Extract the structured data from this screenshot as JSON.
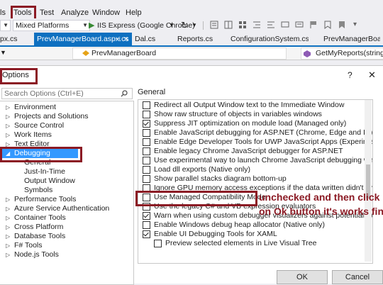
{
  "menu": [
    "ls",
    "Tools",
    "Test",
    "Analyze",
    "Window",
    "Help"
  ],
  "toolbar": {
    "platform": "Mixed Platforms",
    "run_target": "IIS Express (Google Chrome)",
    "refresh_glyph": "↻"
  },
  "tabs": [
    "px.cs",
    "PrevManagerBoard.aspx.cs",
    "Dal.cs",
    "Reports.cs",
    "ConfigurationSystem.cs",
    "PrevManagerBoard.as"
  ],
  "navbar": {
    "class_name": "PrevManagerBoard",
    "member_name": "GetMyReports(string me"
  },
  "dialog": {
    "title": "Options",
    "help": "?",
    "close": "✕",
    "search_placeholder": "Search Options (Ctrl+E)",
    "section_title": "General",
    "ok": "OK",
    "cancel": "Cancel"
  },
  "tree": [
    {
      "label": "Environment",
      "expander": "▷"
    },
    {
      "label": "Projects and Solutions",
      "expander": "▷"
    },
    {
      "label": "Source Control",
      "expander": "▷"
    },
    {
      "label": "Work Items",
      "expander": "▷"
    },
    {
      "label": "Text Editor",
      "expander": "▷"
    },
    {
      "label": "Debugging",
      "expander": "◢"
    },
    {
      "label": "General",
      "expander": ""
    },
    {
      "label": "Just-In-Time",
      "expander": ""
    },
    {
      "label": "Output Window",
      "expander": ""
    },
    {
      "label": "Symbols",
      "expander": ""
    },
    {
      "label": "Performance Tools",
      "expander": "▷"
    },
    {
      "label": "Azure Service Authentication",
      "expander": "▷"
    },
    {
      "label": "Container Tools",
      "expander": "▷"
    },
    {
      "label": "Cross Platform",
      "expander": "▷"
    },
    {
      "label": "Database Tools",
      "expander": "▷"
    },
    {
      "label": "F# Tools",
      "expander": "▷"
    },
    {
      "label": "Node.js Tools",
      "expander": "▷"
    }
  ],
  "options": [
    {
      "label": "Redirect all Output Window text to the Immediate Window",
      "checked": false
    },
    {
      "label": "Show raw structure of objects in variables windows",
      "checked": false
    },
    {
      "label": "Suppress JIT optimization on module load (Managed only)",
      "checked": true
    },
    {
      "label": "Enable JavaScript debugging for ASP.NET (Chrome, Edge and IE)",
      "checked": false
    },
    {
      "label": "Enable Edge Developer Tools for UWP JavaScript Apps (Experimental)",
      "checked": false
    },
    {
      "label": "Enable legacy Chrome JavaScript debugger for ASP.NET",
      "checked": false
    },
    {
      "label": "Use experimental way to launch Chrome JavaScript debugging when running",
      "checked": false
    },
    {
      "label": "Load dll exports (Native only)",
      "checked": false
    },
    {
      "label": "Show parallel stacks diagram bottom-up",
      "checked": false
    },
    {
      "label": "Ignore GPU memory access exceptions if the data written didn't change the v",
      "checked": false
    },
    {
      "label": "Use Managed Compatibility Mode",
      "checked": false
    },
    {
      "label": "Use the legacy C# and VB expression evaluators",
      "checked": false
    },
    {
      "label": "Warn when using custom debugger visualizers against potentially unsafe pro",
      "checked": true
    },
    {
      "label": "Enable Windows debug heap allocator (Native only)",
      "checked": false
    },
    {
      "label": "Enable UI Debugging Tools for XAML",
      "checked": true
    },
    {
      "label": "Preview selected elements in Live Visual Tree",
      "checked": false
    }
  ],
  "annotation": {
    "line1": "unchecked and then click",
    "line2": "on Ok button it's works fine"
  },
  "colors": {
    "annotation": "#8b1a24",
    "selection": "#3399ff",
    "accent": "#0e70c0"
  }
}
